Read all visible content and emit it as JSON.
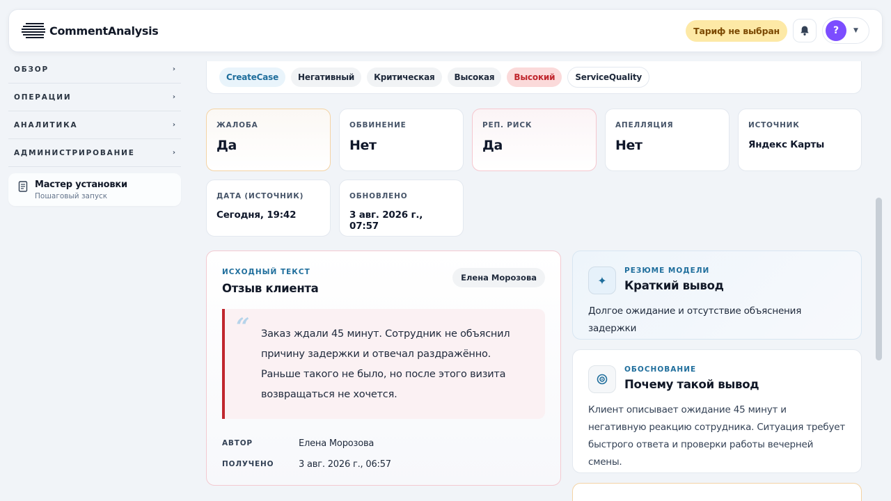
{
  "header": {
    "brand": "CommentAnalysis",
    "tariff_label": "Тариф не выбран",
    "avatar_initial": "?"
  },
  "sidebar": {
    "items": [
      {
        "label": "ОБЗОР"
      },
      {
        "label": "ОПЕРАЦИИ"
      },
      {
        "label": "АНАЛИТИКА"
      },
      {
        "label": "АДМИНИСТРИРОВАНИЕ"
      }
    ],
    "wizard": {
      "title": "Мастер установки",
      "subtitle": "Пошаговый запуск"
    }
  },
  "tags": [
    "CreateCase",
    "Негативный",
    "Критическая",
    "Высокая",
    "Высокий",
    "ServiceQuality"
  ],
  "stats": {
    "complaint": {
      "label": "ЖАЛОБА",
      "value": "Да"
    },
    "accusation": {
      "label": "ОБВИНЕНИЕ",
      "value": "Нет"
    },
    "rep_risk": {
      "label": "РЕП. РИСК",
      "value": "Да"
    },
    "appeal": {
      "label": "АПЕЛЛЯЦИЯ",
      "value": "Нет"
    },
    "source": {
      "label": "ИСТОЧНИК",
      "value": "Яндекс Карты"
    },
    "source_date": {
      "label": "ДАТА (ИСТОЧНИК)",
      "value": "Сегодня, 19:42"
    },
    "updated": {
      "label": "ОБНОВЛЕНО",
      "value": "3 авг. 2026 г., 07:57"
    }
  },
  "source_text": {
    "eyebrow": "ИСХОДНЫЙ ТЕКСТ",
    "title": "Отзыв клиента",
    "author_chip": "Елена Морозова",
    "quote_mark": "“",
    "quote": "Заказ ждали 45 минут. Сотрудник не объяснил причину задержки и отвечал раздражённо. Раньше такого не было, но после этого визита возвращаться не хочется.",
    "author_key": "АВТОР",
    "author_val": "Елена Морозова",
    "received_key": "ПОЛУЧЕНО",
    "received_val": "3 авг. 2026 г., 06:57"
  },
  "summary": {
    "eyebrow": "РЕЗЮМЕ МОДЕЛИ",
    "title": "Краткий вывод",
    "body": "Долгое ожидание и отсутствие объяснения задержки"
  },
  "reasoning": {
    "eyebrow": "ОБОСНОВАНИЕ",
    "title": "Почему такой вывод",
    "body": "Клиент описывает ожидание 45 минут и негативную реакцию сотрудника. Ситуация требует быстрого ответа и проверки работы вечерней смены."
  },
  "colors": {
    "accent_blue": "#1f6e9c",
    "danger_red": "#c0262d",
    "tariff_bg": "#fde9a6",
    "avatar_bg": "#7c4dff"
  }
}
